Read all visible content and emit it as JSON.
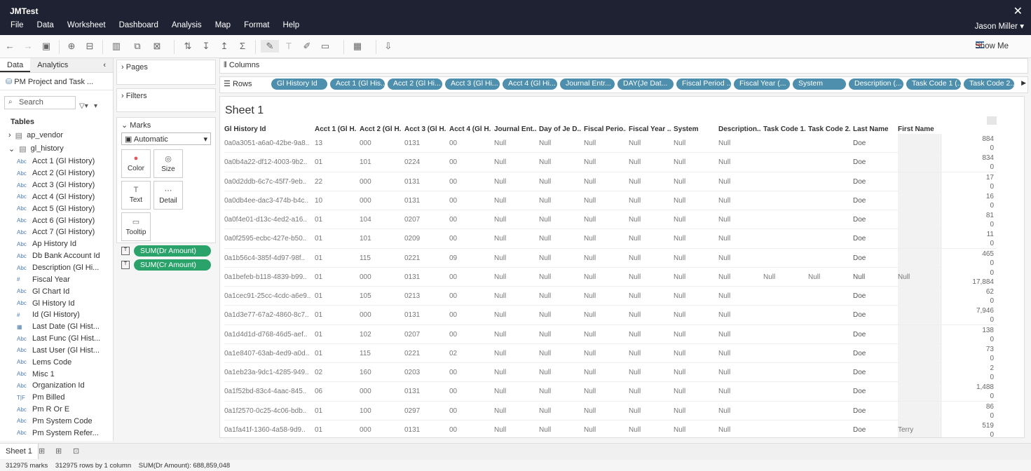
{
  "app": {
    "title": "JMTest",
    "user": "Jason Miller"
  },
  "menu": [
    "File",
    "Data",
    "Worksheet",
    "Dashboard",
    "Analysis",
    "Map",
    "Format",
    "Help"
  ],
  "toolbar": {
    "show_me": "Show Me"
  },
  "left": {
    "tab_data": "Data",
    "tab_analytics": "Analytics",
    "datasource": "PM Project and Task ...",
    "search_placeholder": "Search",
    "tables_label": "Tables",
    "tables": [
      "ap_vendor",
      "gl_history"
    ],
    "fields": [
      {
        "type": "Abc",
        "name": "Acct 1 (Gl History)"
      },
      {
        "type": "Abc",
        "name": "Acct 2 (Gl History)"
      },
      {
        "type": "Abc",
        "name": "Acct 3 (Gl History)"
      },
      {
        "type": "Abc",
        "name": "Acct 4 (Gl History)"
      },
      {
        "type": "Abc",
        "name": "Acct 5 (Gl History)"
      },
      {
        "type": "Abc",
        "name": "Acct 6 (Gl History)"
      },
      {
        "type": "Abc",
        "name": "Acct 7 (Gl History)"
      },
      {
        "type": "Abc",
        "name": "Ap History Id"
      },
      {
        "type": "Abc",
        "name": "Db Bank Account Id"
      },
      {
        "type": "Abc",
        "name": "Description (Gl Hi..."
      },
      {
        "type": "#",
        "name": "Fiscal Year"
      },
      {
        "type": "Abc",
        "name": "Gl Chart Id"
      },
      {
        "type": "Abc",
        "name": "Gl History Id"
      },
      {
        "type": "#",
        "name": "Id (Gl History)"
      },
      {
        "type": "date",
        "name": "Last Date (Gl Hist..."
      },
      {
        "type": "Abc",
        "name": "Last Func (Gl Hist..."
      },
      {
        "type": "Abc",
        "name": "Last User (Gl Hist..."
      },
      {
        "type": "Abc",
        "name": "Lems Code"
      },
      {
        "type": "Abc",
        "name": "Misc 1"
      },
      {
        "type": "Abc",
        "name": "Organization Id"
      },
      {
        "type": "T|F",
        "name": "Pm Billed"
      },
      {
        "type": "Abc",
        "name": "Pm R Or E"
      },
      {
        "type": "Abc",
        "name": "Pm System Code"
      },
      {
        "type": "Abc",
        "name": "Pm System Refer..."
      }
    ]
  },
  "cards": {
    "pages": "Pages",
    "filters": "Filters",
    "marks": "Marks",
    "marks_type": "Automatic",
    "mark_buttons": [
      "Color",
      "Size",
      "Text",
      "Detail",
      "Tooltip"
    ],
    "measures": [
      "SUM(Dr Amount)",
      "SUM(Cr Amount)"
    ]
  },
  "shelves": {
    "columns": "Columns",
    "rows": "Rows",
    "row_pills": [
      "Gl History Id",
      "Acct 1 (Gl His...",
      "Acct 2 (Gl Hi...",
      "Acct 3 (Gl Hi...",
      "Acct 4 (Gl Hi...",
      "Journal Entr...",
      "DAY(Je Dat...",
      "Fiscal Period ...",
      "Fiscal Year (...",
      "System",
      "Description (...",
      "Task Code 1 (...",
      "Task Code 2..."
    ]
  },
  "sheet": {
    "title": "Sheet 1",
    "headers": [
      "Gl History Id",
      "Acct 1 (Gl H...",
      "Acct 2 (Gl H...",
      "Acct 3 (Gl H...",
      "Acct 4 (Gl H...",
      "Journal Ent...",
      "Day of Je D...",
      "Fiscal Perio...",
      "Fiscal Year ...",
      "System",
      "Description...",
      "Task Code 1...",
      "Task Code 2...",
      "Last Name",
      "First Name"
    ],
    "rows": [
      {
        "id": "0a0a3051-a6a0-42be-9a8..",
        "a1": "13",
        "a2": "000",
        "a3": "0131",
        "a4": "00",
        "tc1": "",
        "tc2": "",
        "last": "Doe",
        "first": "",
        "dr": "884",
        "cr": "0"
      },
      {
        "id": "0a0b4a22-df12-4003-9b2..",
        "a1": "01",
        "a2": "101",
        "a3": "0224",
        "a4": "00",
        "tc1": "",
        "tc2": "",
        "last": "Doe",
        "first": "",
        "dr": "834",
        "cr": "0"
      },
      {
        "id": "0a0d2ddb-6c7c-45f7-9eb..",
        "a1": "22",
        "a2": "000",
        "a3": "0131",
        "a4": "00",
        "tc1": "",
        "tc2": "",
        "last": "Doe",
        "first": "",
        "dr": "17",
        "cr": "0"
      },
      {
        "id": "0a0db4ee-dac3-474b-b4c..",
        "a1": "10",
        "a2": "000",
        "a3": "0131",
        "a4": "00",
        "tc1": "",
        "tc2": "",
        "last": "Doe",
        "first": "",
        "dr": "16",
        "cr": "0"
      },
      {
        "id": "0a0f4e01-d13c-4ed2-a16..",
        "a1": "01",
        "a2": "104",
        "a3": "0207",
        "a4": "00",
        "tc1": "",
        "tc2": "",
        "last": "Doe",
        "first": "",
        "dr": "81",
        "cr": "0"
      },
      {
        "id": "0a0f2595-ecbc-427e-b50..",
        "a1": "01",
        "a2": "101",
        "a3": "0209",
        "a4": "00",
        "tc1": "",
        "tc2": "",
        "last": "Doe",
        "first": "",
        "dr": "11",
        "cr": "0"
      },
      {
        "id": "0a1b56c4-385f-4d97-98f..",
        "a1": "01",
        "a2": "115",
        "a3": "0221",
        "a4": "09",
        "tc1": "",
        "tc2": "",
        "last": "Doe",
        "first": "",
        "dr": "465",
        "cr": "0"
      },
      {
        "id": "0a1befeb-b118-4839-b99..",
        "a1": "01",
        "a2": "000",
        "a3": "0131",
        "a4": "00",
        "tc1": "Null",
        "tc2": "Null",
        "last": "Null",
        "first": "Null",
        "dr": "0",
        "cr": "17,884"
      },
      {
        "id": "0a1cec91-25cc-4cdc-a6e9..",
        "a1": "01",
        "a2": "105",
        "a3": "0213",
        "a4": "00",
        "tc1": "",
        "tc2": "",
        "last": "Doe",
        "first": "",
        "dr": "62",
        "cr": "0"
      },
      {
        "id": "0a1d3e77-67a2-4860-8c7..",
        "a1": "01",
        "a2": "000",
        "a3": "0131",
        "a4": "00",
        "tc1": "",
        "tc2": "",
        "last": "Doe",
        "first": "",
        "dr": "7,946",
        "cr": "0"
      },
      {
        "id": "0a1d4d1d-d768-46d5-aef..",
        "a1": "01",
        "a2": "102",
        "a3": "0207",
        "a4": "00",
        "tc1": "",
        "tc2": "",
        "last": "Doe",
        "first": "",
        "dr": "138",
        "cr": "0"
      },
      {
        "id": "0a1e8407-63ab-4ed9-a0d..",
        "a1": "01",
        "a2": "115",
        "a3": "0221",
        "a4": "02",
        "tc1": "",
        "tc2": "",
        "last": "Doe",
        "first": "",
        "dr": "73",
        "cr": "0"
      },
      {
        "id": "0a1eb23a-9dc1-4285-949..",
        "a1": "02",
        "a2": "160",
        "a3": "0203",
        "a4": "00",
        "tc1": "",
        "tc2": "",
        "last": "Doe",
        "first": "",
        "dr": "2",
        "cr": "0"
      },
      {
        "id": "0a1f52bd-83c4-4aac-845..",
        "a1": "06",
        "a2": "000",
        "a3": "0131",
        "a4": "00",
        "tc1": "",
        "tc2": "",
        "last": "Doe",
        "first": "",
        "dr": "1,488",
        "cr": "0"
      },
      {
        "id": "0a1f2570-0c25-4c06-bdb..",
        "a1": "01",
        "a2": "100",
        "a3": "0297",
        "a4": "00",
        "tc1": "",
        "tc2": "",
        "last": "Doe",
        "first": "",
        "dr": "86",
        "cr": "0"
      },
      {
        "id": "0a1fa41f-1360-4a58-9d9..",
        "a1": "01",
        "a2": "000",
        "a3": "0131",
        "a4": "00",
        "tc1": "",
        "tc2": "",
        "last": "Doe",
        "first": "Terry",
        "dr": "519",
        "cr": "0"
      }
    ],
    "null_label": "Null"
  },
  "bottom": {
    "sheet_tab": "Sheet 1"
  },
  "status": {
    "marks": "312975 marks",
    "rows": "312975 rows by 1 column",
    "sum": "SUM(Dr Amount): 688,859,048"
  }
}
